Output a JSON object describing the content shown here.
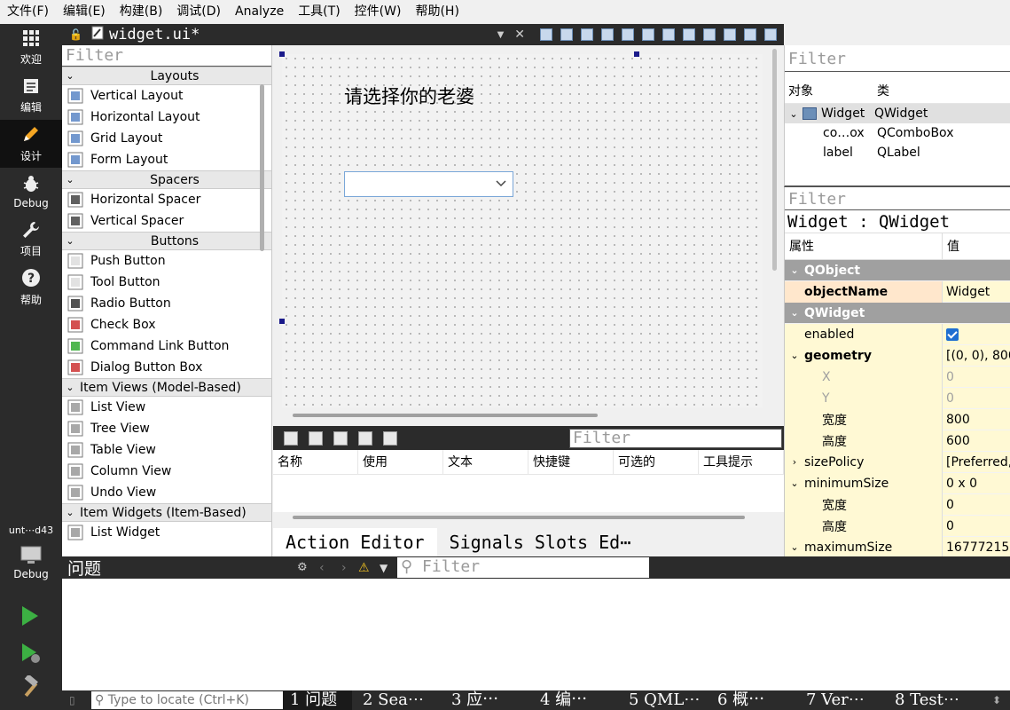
{
  "menu": [
    "文件(F)",
    "编辑(E)",
    "构建(B)",
    "调试(D)",
    "Analyze",
    "工具(T)",
    "控件(W)",
    "帮助(H)"
  ],
  "modes": [
    {
      "label": "欢迎",
      "icon": "grid-icon"
    },
    {
      "label": "编辑",
      "icon": "document-icon"
    },
    {
      "label": "设计",
      "icon": "pencil-icon",
      "active": true
    },
    {
      "label": "Debug",
      "icon": "bug-icon"
    },
    {
      "label": "项目",
      "icon": "wrench-icon"
    },
    {
      "label": "帮助",
      "icon": "help-icon"
    }
  ],
  "kit": {
    "name": "unt⋯d43",
    "label": "Debug"
  },
  "doc": {
    "filename": "widget.ui*"
  },
  "widgetbox": {
    "filter_placeholder": "Filter",
    "categories": [
      {
        "name": "Layouts",
        "items": [
          "Vertical Layout",
          "Horizontal Layout",
          "Grid Layout",
          "Form Layout"
        ]
      },
      {
        "name": "Spacers",
        "items": [
          "Horizontal Spacer",
          "Vertical Spacer"
        ]
      },
      {
        "name": "Buttons",
        "items": [
          "Push Button",
          "Tool Button",
          "Radio Button",
          "Check Box",
          "Command Link Button",
          "Dialog Button Box"
        ]
      },
      {
        "name": "Item Views (Model-Based)",
        "items": [
          "List View",
          "Tree View",
          "Table View",
          "Column View",
          "Undo View"
        ]
      },
      {
        "name": "Item Widgets (Item-Based)",
        "items": [
          "List Widget"
        ]
      }
    ]
  },
  "form": {
    "label_text": "请选择你的老婆"
  },
  "action_editor": {
    "filter_placeholder": "Filter",
    "columns": [
      "名称",
      "使用",
      "文本",
      "快捷键",
      "可选的",
      "工具提示"
    ],
    "tabs": [
      "Action Editor",
      "Signals Slots Ed⋯"
    ]
  },
  "object_inspector": {
    "filter_placeholder": "Filter",
    "columns": [
      "对象",
      "类"
    ],
    "rows": [
      {
        "object": "Widget",
        "class": "QWidget"
      },
      {
        "object": "co…ox",
        "class": "QComboBox"
      },
      {
        "object": "label",
        "class": "QLabel"
      }
    ]
  },
  "property_editor": {
    "filter_placeholder": "Filter",
    "title": "Widget : QWidget",
    "columns": [
      "属性",
      "值"
    ],
    "rows": [
      {
        "name": "QObject",
        "value": "",
        "type": "group"
      },
      {
        "name": "objectName",
        "value": "Widget",
        "type": "bold",
        "style": "orange"
      },
      {
        "name": "QWidget",
        "value": "",
        "type": "group"
      },
      {
        "name": "enabled",
        "value": "",
        "checkbox": true,
        "style": "yellow"
      },
      {
        "name": "geometry",
        "value": "[(0, 0), 800",
        "type": "bold",
        "expand": "open",
        "style": "yellow"
      },
      {
        "name": "X",
        "value": "0",
        "indent": true,
        "disabled": true,
        "style": "yellow"
      },
      {
        "name": "Y",
        "value": "0",
        "indent": true,
        "disabled": true,
        "style": "yellow"
      },
      {
        "name": "宽度",
        "value": "800",
        "indent": true,
        "style": "yellow"
      },
      {
        "name": "高度",
        "value": "600",
        "indent": true,
        "style": "yellow"
      },
      {
        "name": "sizePolicy",
        "value": "[Preferred,",
        "expand": "closed",
        "style": "yellow"
      },
      {
        "name": "minimumSize",
        "value": "0 x 0",
        "expand": "open",
        "style": "yellow"
      },
      {
        "name": "宽度",
        "value": "0",
        "indent": true,
        "style": "yellow"
      },
      {
        "name": "高度",
        "value": "0",
        "indent": true,
        "style": "yellow"
      },
      {
        "name": "maximumSize",
        "value": "16777215",
        "expand": "open",
        "style": "yellow"
      }
    ]
  },
  "issues": {
    "title": "问题",
    "filter_placeholder": "Filter"
  },
  "statusbar": {
    "locate_placeholder": "Type to locate (Ctrl+K)",
    "tabs": [
      "1 问题",
      "2 Sea⋯",
      "3 应⋯",
      "4 编⋯",
      "5 QML⋯",
      "6 概⋯",
      "7 Ver⋯",
      "8 Test⋯"
    ]
  },
  "colors": {
    "dark": "#2b2b2b",
    "group": "#a0a0a0",
    "value_bg": "#fff9d4",
    "accent": "#1f6fd1"
  }
}
